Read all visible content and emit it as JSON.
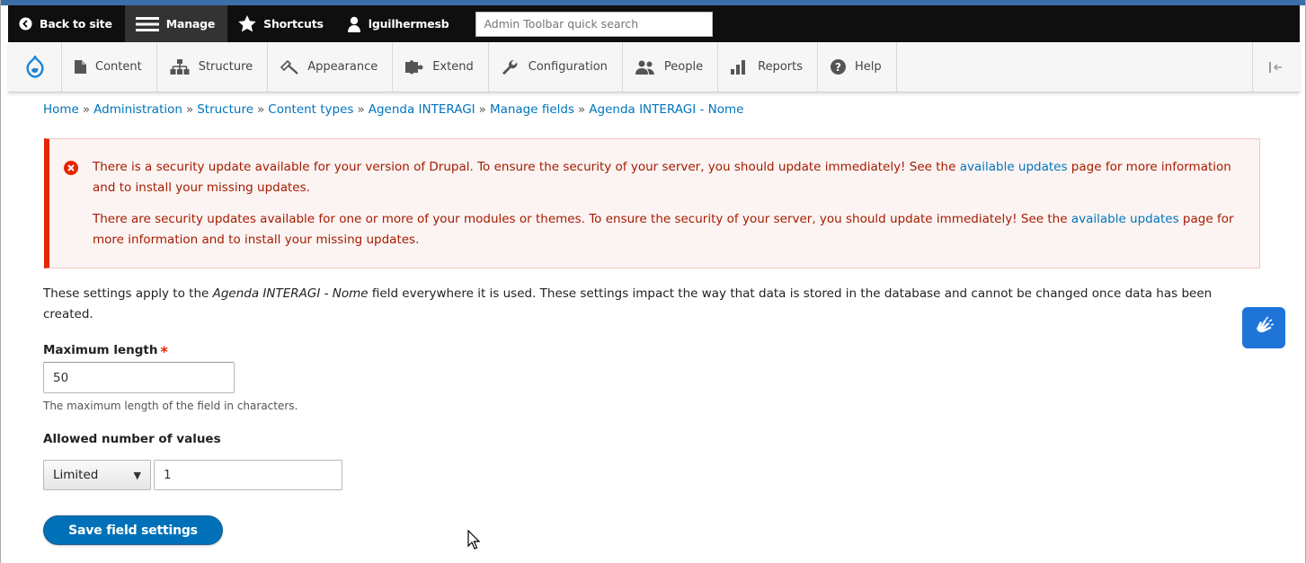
{
  "admin_toolbar": {
    "back_label": "Back to site",
    "manage_label": "Manage",
    "shortcuts_label": "Shortcuts",
    "user_label": "lguilhermesb",
    "quick_search_placeholder": "Admin Toolbar quick search"
  },
  "menu": {
    "items": [
      {
        "label": "Content",
        "icon": "file-icon"
      },
      {
        "label": "Structure",
        "icon": "sitemap-icon"
      },
      {
        "label": "Appearance",
        "icon": "paintbrush-icon"
      },
      {
        "label": "Extend",
        "icon": "puzzle-icon"
      },
      {
        "label": "Configuration",
        "icon": "wrench-icon"
      },
      {
        "label": "People",
        "icon": "people-icon"
      },
      {
        "label": "Reports",
        "icon": "bar-chart-icon"
      },
      {
        "label": "Help",
        "icon": "help-icon"
      }
    ]
  },
  "breadcrumb": {
    "items": [
      "Home",
      "Administration",
      "Structure",
      "Content types",
      "Agenda INTERAGI",
      "Manage fields",
      "Agenda INTERAGI - Nome"
    ],
    "separator": "»"
  },
  "alert": {
    "msg1_pre": "There is a security update available for your version of Drupal. To ensure the security of your server, you should update immediately! See the ",
    "msg1_link": "available updates",
    "msg1_post": " page for more information and to install your missing updates.",
    "msg2_pre": "There are security updates available for one or more of your modules or themes. To ensure the security of your server, you should update immediately! See the ",
    "msg2_link": "available updates",
    "msg2_post": " page for more information and to install your missing updates."
  },
  "description": {
    "pre": "These settings apply to the ",
    "field_name": "Agenda INTERAGI - Nome",
    "post": " field everywhere it is used. These settings impact the way that data is stored in the database and cannot be changed once data has been created."
  },
  "form": {
    "max_length_label": "Maximum length",
    "required_marker": "*",
    "max_length_value": "50",
    "max_length_help": "The maximum length of the field in characters.",
    "allowed_values_label": "Allowed number of values",
    "cardinality_selected": "Limited",
    "cardinality_number": "1",
    "save_label": "Save field settings"
  },
  "colors": {
    "toolbar_black": "#0f0f0f",
    "link_blue": "#0074bd",
    "error_red": "#e62600",
    "button_blue": "#0071b8"
  }
}
